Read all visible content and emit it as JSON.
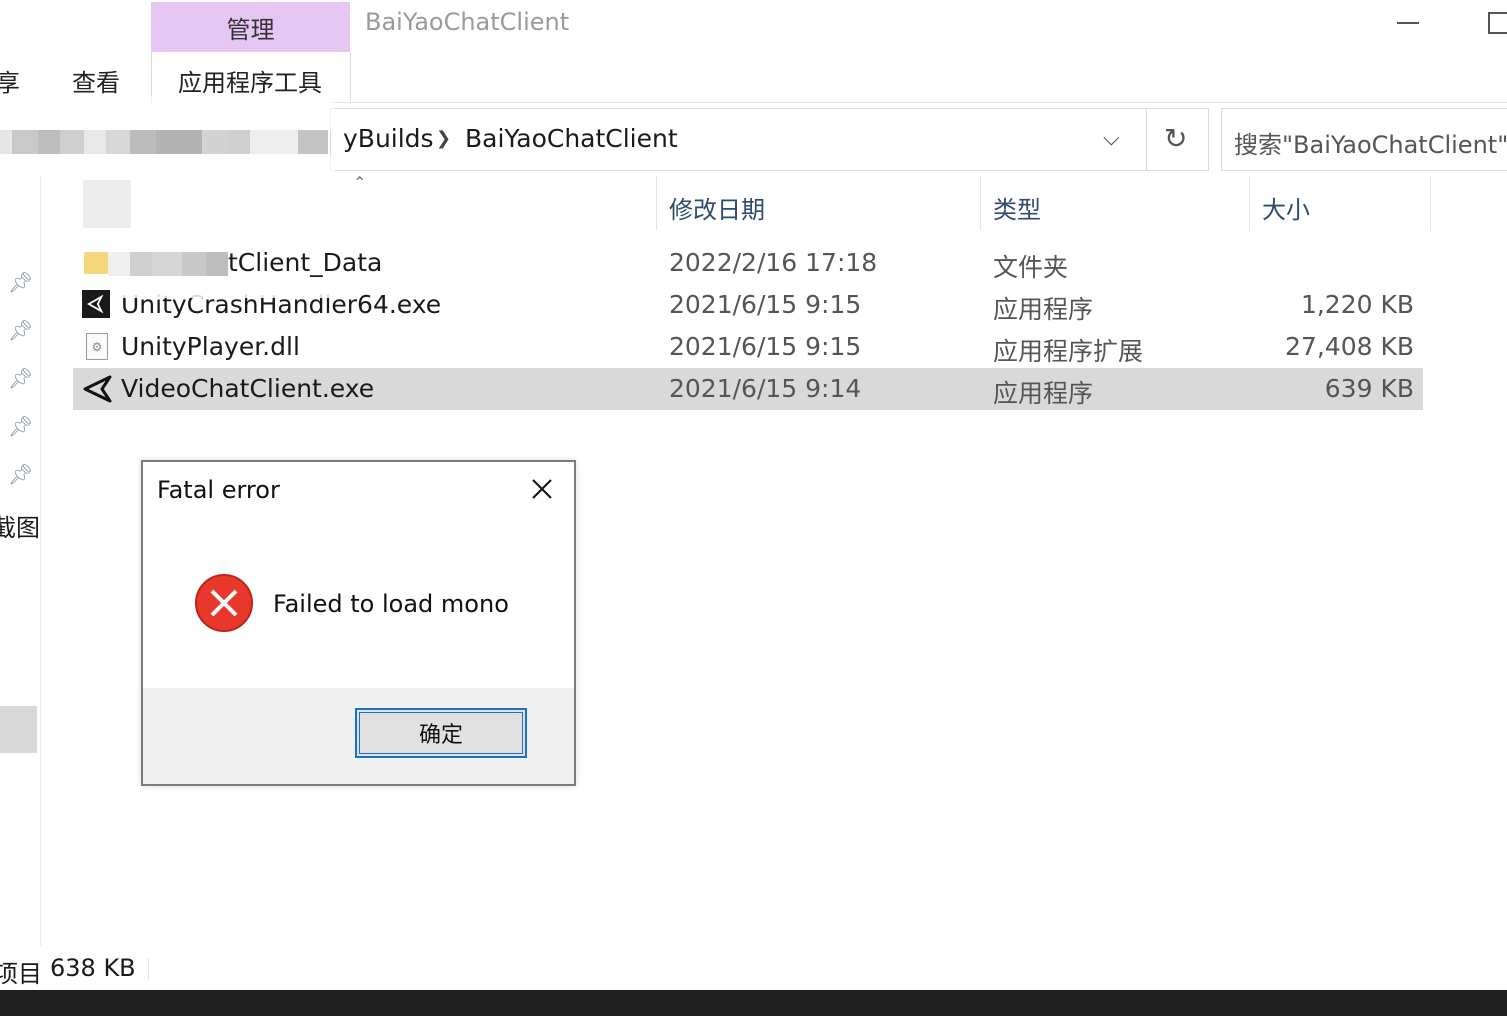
{
  "window": {
    "title": "BaiYaoChatClient",
    "minimize_icon": "minimize-icon",
    "maximize_icon": "maximize-icon"
  },
  "ribbon": {
    "tab_partial_share": "享",
    "tab_view": "查看",
    "contextual_group": "管理",
    "contextual_tab": "应用程序工具"
  },
  "address_bar": {
    "crumb_parent_partial": "yBuilds",
    "crumb_current": "BaiYaoChatClient",
    "refresh_icon": "refresh-icon",
    "dropdown_icon": "chevron-down-icon"
  },
  "search": {
    "placeholder": "搜索\"BaiYaoChatClient\""
  },
  "nav_pane": {
    "partial_item": "截图",
    "pins": [
      "pin-icon",
      "pin-icon",
      "pin-icon",
      "pin-icon",
      "pin-icon"
    ]
  },
  "columns": {
    "date": "修改日期",
    "type": "类型",
    "size": "大小"
  },
  "files": [
    {
      "name": "tClient_Data",
      "date": "2022/2/16 17:18",
      "type": "文件夹",
      "size": "",
      "icon": "folder-icon"
    },
    {
      "name": "UnityCrashHandler64.exe",
      "date": "2021/6/15 9:15",
      "type": "应用程序",
      "size": "1,220 KB",
      "icon": "unity-icon"
    },
    {
      "name": "UnityPlayer.dll",
      "date": "2021/6/15 9:15",
      "type": "应用程序扩展",
      "size": "27,408 KB",
      "icon": "dll-file-icon"
    },
    {
      "name": "VideoChatClient.exe",
      "date": "2021/6/15 9:14",
      "type": "应用程序",
      "size": "639 KB",
      "icon": "unity-icon"
    }
  ],
  "dialog": {
    "title": "Fatal error",
    "message": "Failed to load mono",
    "ok_label": "确定",
    "icon": "error-icon",
    "close_icon": "close-icon"
  },
  "status_bar": {
    "items_partial": "项目",
    "selection_size": "638 KB"
  },
  "colors": {
    "contextual_tab_bg": "#e6c7f4",
    "selection_bg": "#d9d9d9",
    "error_red": "#e8372c",
    "focus_blue": "#1a73c9"
  }
}
